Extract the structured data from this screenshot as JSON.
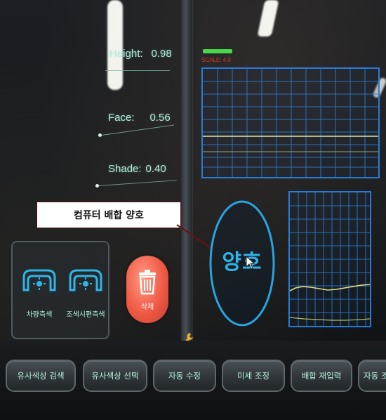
{
  "readouts": {
    "height": {
      "label": "Height:",
      "value": "0.98"
    },
    "face": {
      "label": "Face:",
      "value": "0.56"
    },
    "shade": {
      "label": "Shade:",
      "value": "0.40"
    }
  },
  "upper_chart": {
    "scale_label": "SCALE: 4.0"
  },
  "callout": {
    "text": "컴퓨터 배합 양호"
  },
  "status": {
    "text": "양호"
  },
  "measure_buttons": [
    {
      "label": "차량측색",
      "icon": "measure-camera-icon"
    },
    {
      "label": "조색시편측색",
      "icon": "measure-camera-icon"
    }
  ],
  "delete_button": {
    "label": "삭제",
    "icon": "trash-icon"
  },
  "wrench": {
    "icon": "wrench-icon"
  },
  "actions": [
    "유사색상 검색",
    "유사색상 선택",
    "자동 수정",
    "미세 조정",
    "배합 재입력",
    "자동 조"
  ],
  "colors": {
    "accent": "#2a9bd8",
    "readout_text": "#b8e8d8",
    "delete_red": "#ef5a45",
    "indicator_green": "#49d84a"
  }
}
